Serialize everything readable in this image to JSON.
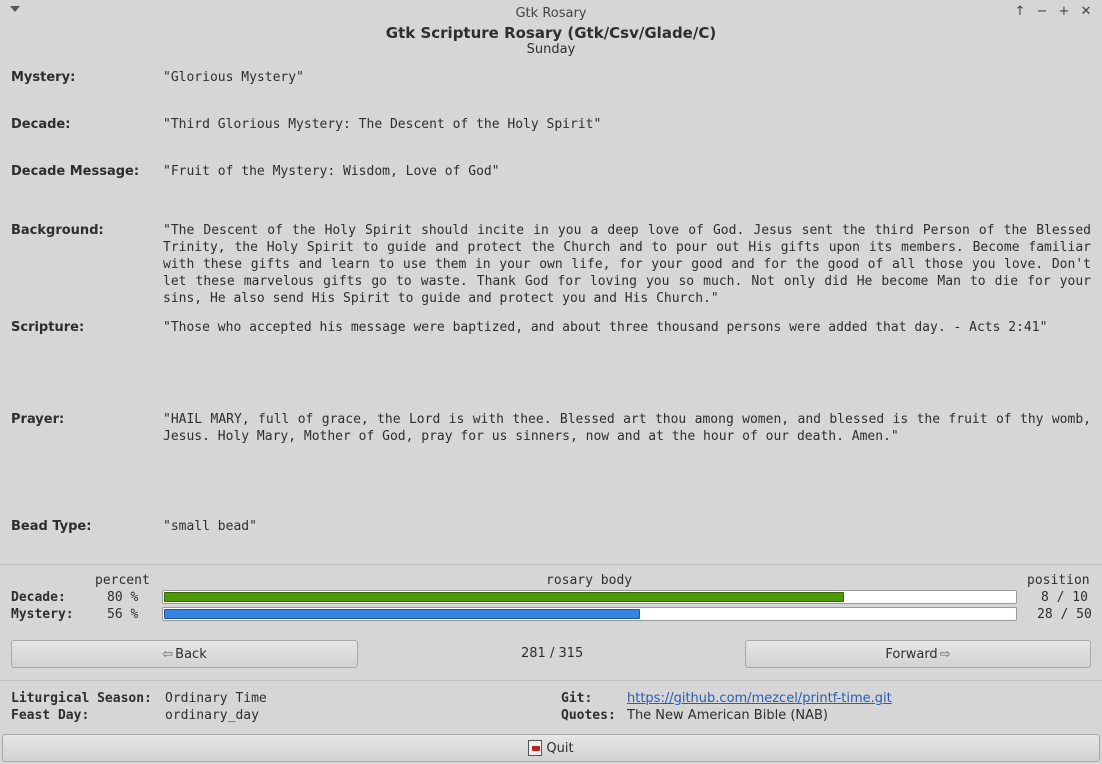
{
  "window": {
    "title": "Gtk Rosary",
    "app_title": "Gtk Scripture Rosary (Gtk/Csv/Glade/C)",
    "day": "Sunday",
    "buttons": [
      "↑",
      "−",
      "+",
      "✕"
    ]
  },
  "fields": {
    "mystery_label": "Mystery:",
    "mystery_value": "\"Glorious Mystery\"",
    "decade_label": "Decade:",
    "decade_value": "\"Third Glorious Mystery: The Descent of the Holy Spirit\"",
    "decade_message_label": "Decade Message:",
    "decade_message_value": "\"Fruit of the Mystery: Wisdom, Love of God\"",
    "background_label": "Background:",
    "background_value": "\"The Descent of the Holy Spirit should incite in you a deep love of God. Jesus sent the third Person of the Blessed Trinity, the Holy Spirit to guide and protect the Church and to pour out His gifts upon its members. Become familiar with these gifts and learn to use them in your own life, for your good and for the good of all those you love. Don't let these marvelous gifts go to waste. Thank God for loving you so much. Not only did He become Man to die for your sins, He also send His Spirit to guide and protect you and His Church.\"",
    "scripture_label": "Scripture:",
    "scripture_value": "\"Those who accepted his message were baptized, and about three thousand persons were added that day. - Acts 2:41\"",
    "prayer_label": "Prayer:",
    "prayer_value": "\"HAIL MARY, full of grace, the Lord is with thee. Blessed art thou among women, and blessed is the fruit of thy womb, Jesus. Holy Mary, Mother of God, pray for us sinners, now and at the hour of our death. Amen.\"",
    "bead_type_label": "Bead Type:",
    "bead_type_value": "\"small bead\""
  },
  "progress": {
    "percent_header": "percent",
    "body_header": "rosary body",
    "position_header": "position",
    "decade": {
      "label": "Decade:",
      "percent": "80 %",
      "fraction": 0.8,
      "position": "8 / 10",
      "color": "#4e9a06"
    },
    "mystery": {
      "label": "Mystery:",
      "percent": "56 %",
      "fraction": 0.56,
      "position": "28 / 50",
      "color": "#3584e4"
    }
  },
  "navigation": {
    "back_label": "Back",
    "counter": "281 / 315",
    "forward_label": "Forward"
  },
  "footer": {
    "season_label": "Liturgical Season:",
    "season_value": "Ordinary Time",
    "feast_label": "Feast Day:",
    "feast_value": "ordinary_day",
    "git_label": "Git:",
    "git_value": "https://github.com/mezcel/printf-time.git",
    "quotes_label": "Quotes:",
    "quotes_value": "The New American Bible (NAB)",
    "quit_label": "Quit"
  }
}
